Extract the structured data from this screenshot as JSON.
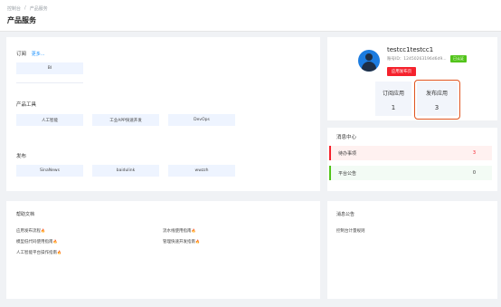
{
  "breadcrumb": [
    "控制台",
    "/",
    "产品服务"
  ],
  "page_title": "产品服务",
  "subscribe": {
    "title": "订阅",
    "more": "更多...",
    "items": [
      "BI"
    ]
  },
  "tools": {
    "title": "产品工具",
    "items": [
      "人工智能",
      "工业APP快速开发",
      "DevOps"
    ]
  },
  "publish": {
    "title": "发布",
    "items": [
      "SinaNews",
      "baidulink",
      "wwzzh"
    ]
  },
  "user": {
    "name": "testcc1testcc1",
    "account": "账号ID：12450263196d6d9...",
    "verified": "已认证",
    "developer_button": "应用发布页",
    "stats": [
      {
        "label": "订阅应用",
        "value": "1"
      },
      {
        "label": "发布应用",
        "value": "3"
      }
    ]
  },
  "messages": {
    "title": "消息中心",
    "items": [
      {
        "label": "待办事项",
        "count": "3"
      },
      {
        "label": "平台公告",
        "count": "0"
      }
    ]
  },
  "help": {
    "title": "帮助文档",
    "left": [
      "应用发布流程",
      "模型低代码使用指南",
      "人工智能平台操作指南"
    ],
    "right": [
      "流水线使用指南",
      "管理快速开发指南"
    ]
  },
  "notice": {
    "title": "消息公告",
    "items": [
      "控制台计量规则"
    ]
  },
  "colors": {
    "accent": "#1890ff",
    "verified": "#52c41a",
    "danger": "#f5222d",
    "highlight": "#e0541f"
  }
}
